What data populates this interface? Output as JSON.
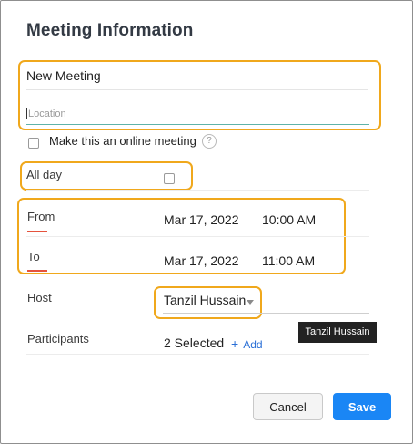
{
  "dialog": {
    "title": "Meeting Information"
  },
  "meeting": {
    "name": "New Meeting",
    "location_placeholder": "Location",
    "online_label": "Make this an online meeting",
    "help_glyph": "?"
  },
  "all_day": {
    "label": "All day",
    "checked": false
  },
  "from": {
    "label": "From",
    "date": "Mar 17, 2022",
    "time": "10:00 AM"
  },
  "to": {
    "label": "To",
    "date": "Mar 17, 2022",
    "time": "11:00 AM"
  },
  "host": {
    "label": "Host",
    "value": "Tanzil Hussain",
    "tooltip": "Tanzil Hussain"
  },
  "participants": {
    "label": "Participants",
    "count_text": "2 Selected",
    "add_label": "Add",
    "add_glyph": "+"
  },
  "footer": {
    "cancel_label": "Cancel",
    "save_label": "Save"
  },
  "colors": {
    "highlight": "#f0a81c",
    "accent_blue": "#1a86f5",
    "required_red": "#e5533d",
    "focus_teal": "#5fb3a8"
  }
}
